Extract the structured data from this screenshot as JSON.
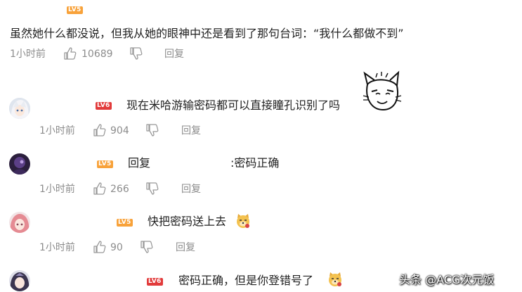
{
  "top_comment": {
    "level": "LV5",
    "text": "虽然她什么都没说，但我从她的眼神中还是看到了那句台词：“我什么都做不到”",
    "time": "1小时前",
    "likes": "10689",
    "reply_label": "回复"
  },
  "replies": [
    {
      "level": "LV6",
      "text": "现在米哈游输密码都可以直接瞳孔识别了吗",
      "time": "1小时前",
      "likes": "904",
      "reply_label": "回复",
      "avatar_icon": "anime-girl-white-hair-avatar"
    },
    {
      "level": "LV5",
      "prefix": "回复",
      "text": ":密码正确",
      "time": "1小时前",
      "likes": "266",
      "reply_label": "回复",
      "avatar_icon": "dark-purple-avatar"
    },
    {
      "level": "LV5",
      "text": "快把密码送上去",
      "time": "1小时前",
      "likes": "90",
      "reply_label": "回复",
      "avatar_icon": "pink-hair-avatar"
    },
    {
      "level": "LV6",
      "text": "密码正确，但是你登错号了",
      "avatar_icon": "dark-hair-avatar"
    }
  ],
  "watermark": "头条 @ACG次元饭",
  "colors": {
    "meta_gray": "#8c8c8c",
    "level_orange": "#f8a23a",
    "level_red": "#e23b3b"
  }
}
